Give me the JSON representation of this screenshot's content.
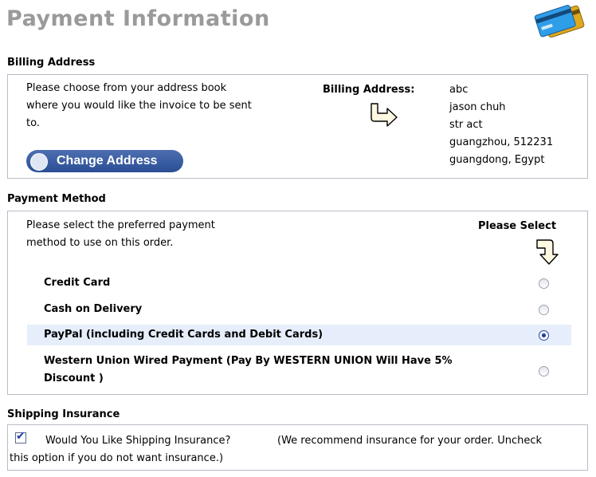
{
  "page": {
    "title": "Payment Information"
  },
  "billing": {
    "section_title": "Billing Address",
    "instructions": [
      "Please choose from your address book",
      "where you would like the invoice to be sent",
      "to."
    ],
    "change_button": "Change Address",
    "address_label": "Billing Address:",
    "address_lines": [
      "abc",
      "jason chuh",
      "str act",
      "guangzhou, 512231",
      "guangdong, Egypt"
    ]
  },
  "payment": {
    "section_title": "Payment Method",
    "instructions": [
      "Please select the preferred payment",
      "method to use on this order."
    ],
    "select_label": "Please Select",
    "methods": [
      {
        "label": "Credit Card",
        "selected": false
      },
      {
        "label": "Cash on Delivery",
        "selected": false
      },
      {
        "label": "PayPal (including Credit Cards and Debit Cards)",
        "selected": true
      },
      {
        "label_line1": "Western Union Wired Payment (Pay By WESTERN UNION Will Have 5%",
        "label_line2": "Discount )",
        "selected": false
      }
    ]
  },
  "insurance": {
    "section_title": "Shipping Insurance",
    "checked": true,
    "question": "Would You Like Shipping Insurance?",
    "note_line1": "(We recommend insurance for your order. Uncheck",
    "note_line2": "this option if you do not want insurance.)"
  },
  "icons": {
    "credit_card": "credit-card-icon",
    "arrow_right": "curved-arrow-right-icon",
    "arrow_down": "curved-arrow-down-icon"
  },
  "colors": {
    "title_gray": "#9a9a9a",
    "button_blue": "#2a4e95",
    "selected_row": "#e6eefb",
    "box_border": "#b7bcc6"
  }
}
